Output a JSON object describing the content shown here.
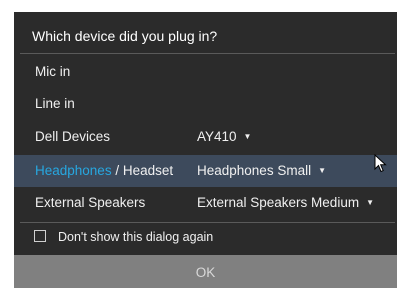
{
  "dialog": {
    "title": "Which device did you plug in?",
    "rows": [
      {
        "label": "Mic in"
      },
      {
        "label": "Line in"
      },
      {
        "label": "Dell Devices",
        "value": "AY410"
      },
      {
        "label_primary": "Headphones",
        "label_separator": " / ",
        "label_secondary": "Headset",
        "value": "Headphones Small",
        "selected": true
      },
      {
        "label": "External Speakers",
        "value": "External Speakers Medium"
      }
    ],
    "dont_show_again_label": "Don't show this dialog again",
    "dont_show_again_checked": false,
    "ok_label": "OK"
  },
  "icons": {
    "dropdown": "chevron-down-icon",
    "pointer": "mouse-pointer-icon"
  },
  "colors": {
    "dialog_bg": "#2b2b2b",
    "selected_row_bg": "#3d4a5c",
    "accent": "#27a7e0",
    "ok_bar": "#808080"
  }
}
